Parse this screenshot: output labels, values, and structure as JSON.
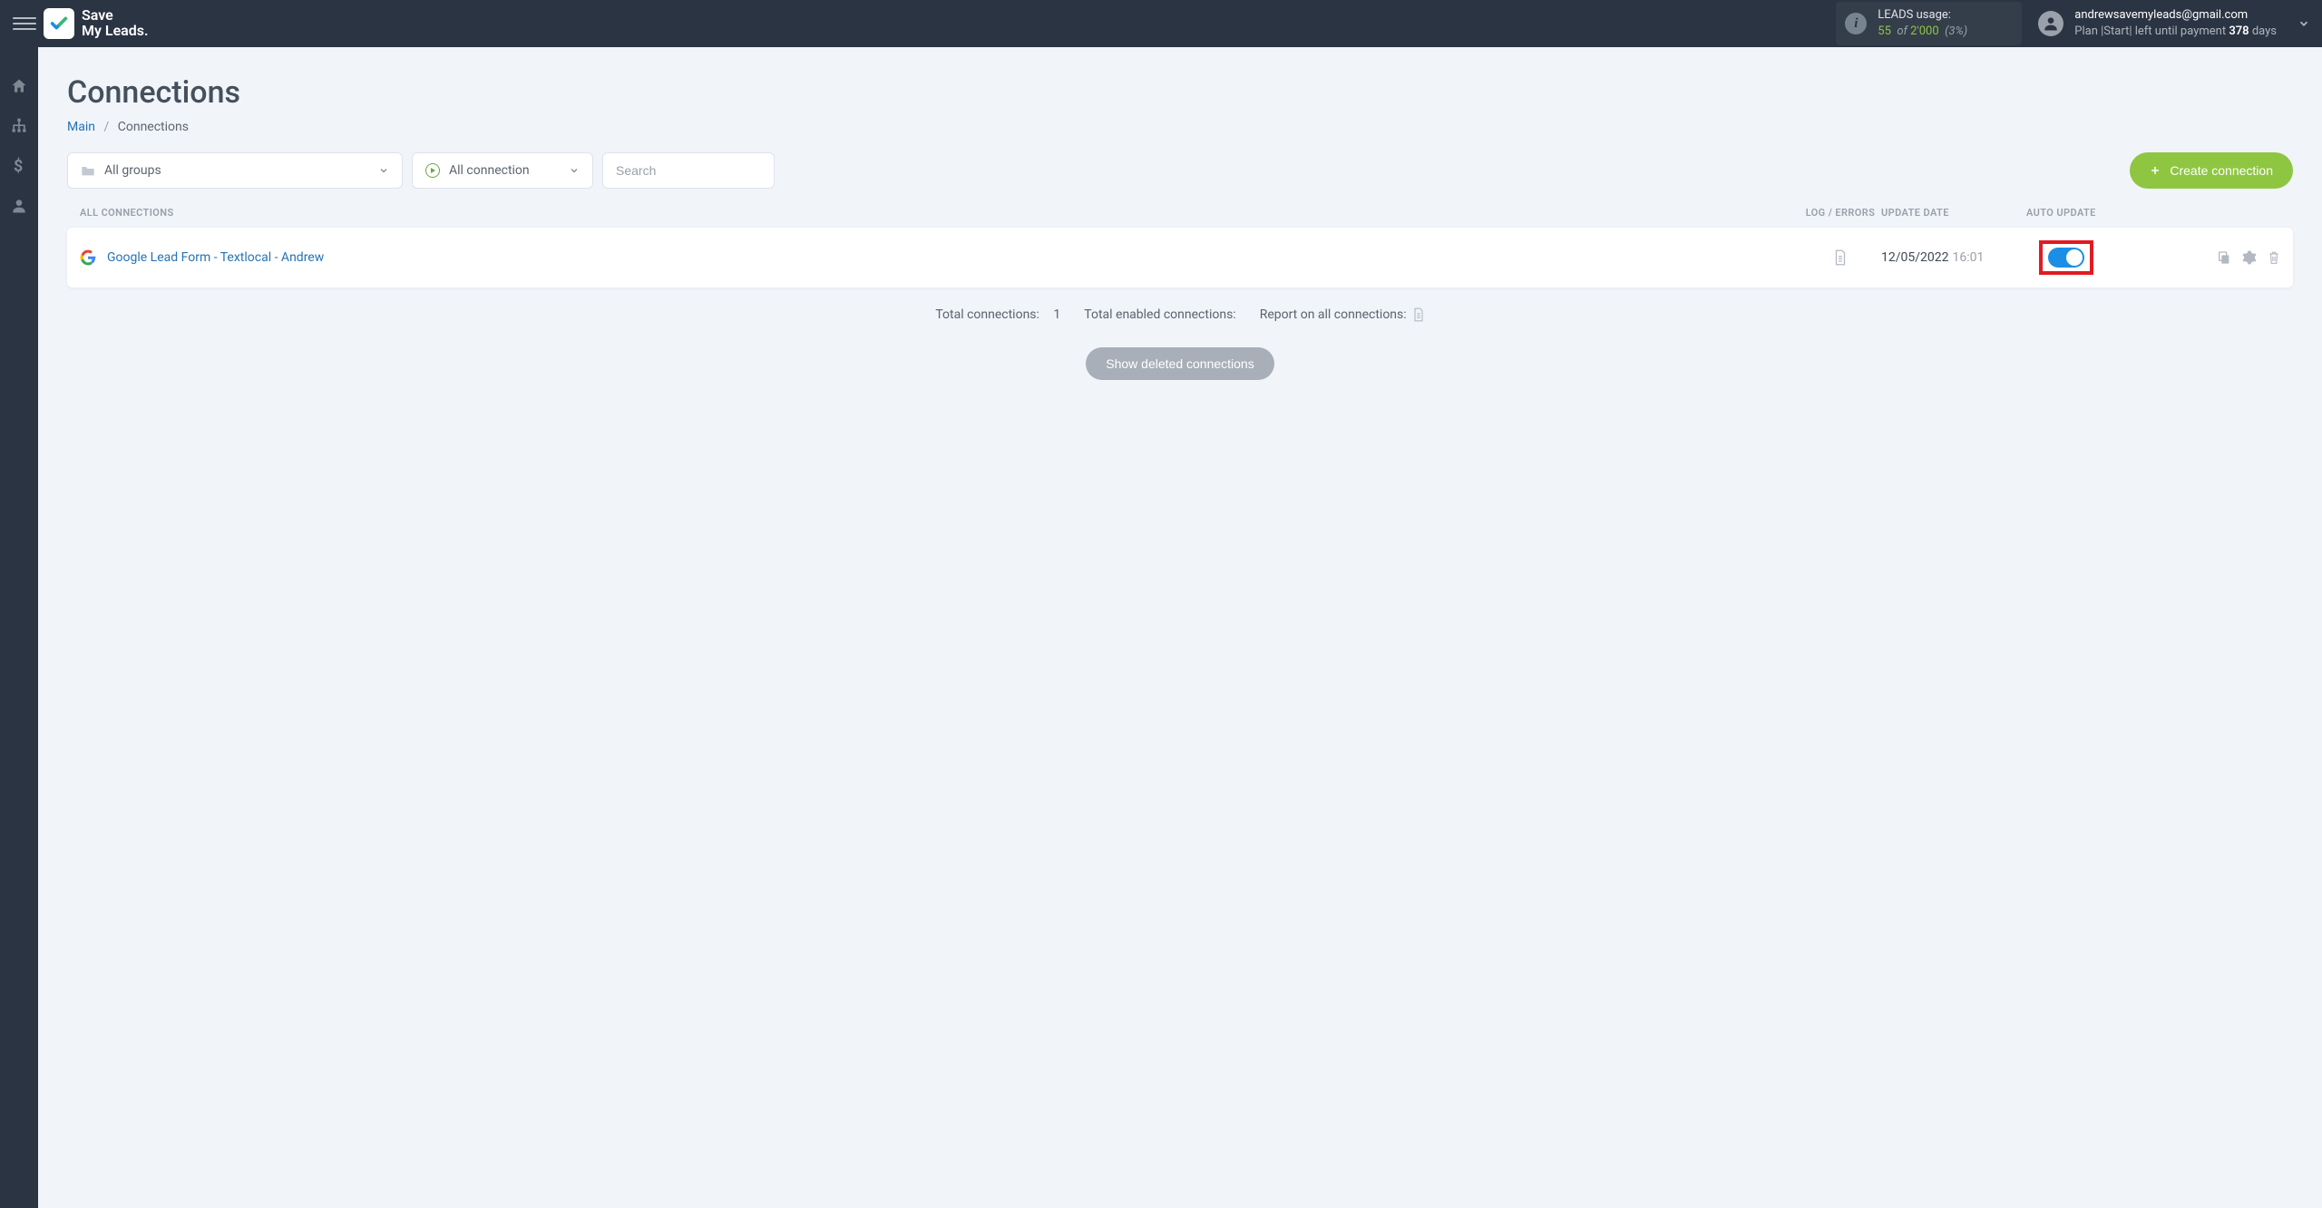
{
  "logo": {
    "line1": "Save",
    "line2": "My Leads."
  },
  "header": {
    "leads_label": "LEADS usage:",
    "leads_used": "55",
    "leads_of": "of",
    "leads_total": "2'000",
    "leads_pct": "(3%)",
    "user_email": "andrewsavemyleads@gmail.com",
    "plan_prefix": "Plan |",
    "plan_name": "Start",
    "plan_mid": "| left until payment ",
    "plan_days": "378",
    "plan_suffix": " days"
  },
  "page": {
    "title": "Connections",
    "breadcrumb_main": "Main",
    "breadcrumb_current": "Connections"
  },
  "filters": {
    "groups_label": "All groups",
    "conn_label": "All connection",
    "search_placeholder": "Search",
    "create_label": "Create connection"
  },
  "columns": {
    "name": "ALL CONNECTIONS",
    "log": "LOG / ERRORS",
    "update": "UPDATE DATE",
    "auto": "AUTO UPDATE"
  },
  "rows": [
    {
      "name": "Google Lead Form - Textlocal - Andrew",
      "date": "12/05/2022",
      "time": "16:01",
      "auto_on": true
    }
  ],
  "summary": {
    "total_label": "Total connections:",
    "total_value": "1",
    "enabled_label": "Total enabled connections:",
    "report_label": "Report on all connections:"
  },
  "buttons": {
    "show_deleted": "Show deleted connections"
  }
}
